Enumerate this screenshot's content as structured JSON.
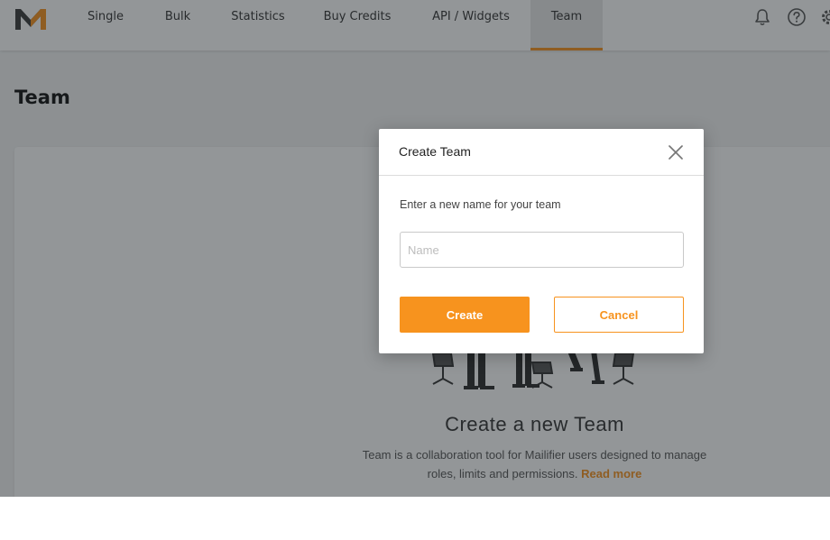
{
  "nav": {
    "items": [
      {
        "label": "Single"
      },
      {
        "label": "Bulk"
      },
      {
        "label": "Statistics"
      },
      {
        "label": "Buy Credits"
      },
      {
        "label": "API / Widgets"
      },
      {
        "label": "Team"
      }
    ],
    "active": "Team",
    "icons": [
      "bell-icon",
      "help-icon",
      "gear-icon"
    ]
  },
  "page": {
    "title": "Team"
  },
  "empty_state": {
    "title": "Create a new Team",
    "description": "Team is a collaboration tool for Mailifier users designed to manage roles, limits and permissions.",
    "read_more": "Read more"
  },
  "modal": {
    "title": "Create Team",
    "label": "Enter a new name for your team",
    "input_placeholder": "Name",
    "input_value": "",
    "create_label": "Create",
    "cancel_label": "Cancel"
  },
  "colors": {
    "accent": "#f7931e",
    "logo_dark": "#3a3a3a"
  }
}
